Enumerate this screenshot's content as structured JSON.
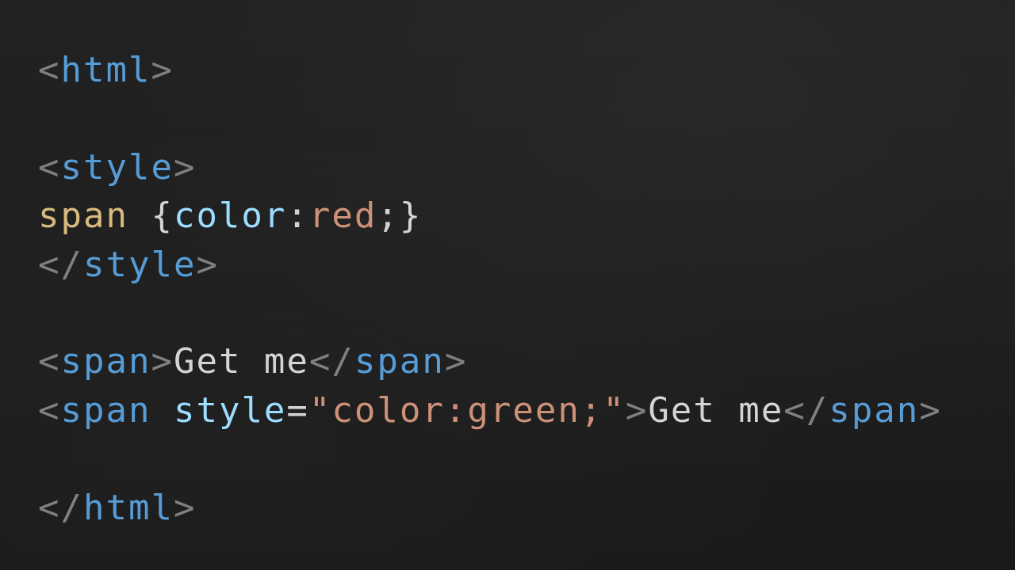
{
  "colors": {
    "background": "#1c1c1c",
    "punctuation": "#808080",
    "tag": "#569cd6",
    "text": "#d4d4d4",
    "selector": "#d7ba7d",
    "property": "#9cdcfe",
    "value": "#ce9178"
  },
  "code": {
    "l1": {
      "open": "<",
      "tag": "html",
      "close": ">"
    },
    "l3": {
      "open": "<",
      "tag": "style",
      "close": ">"
    },
    "l4": {
      "selector": "span",
      "brace_open": " {",
      "property": "color",
      "colon": ":",
      "value": "red",
      "semi": ";",
      "brace_close": "}"
    },
    "l5": {
      "open": "</",
      "tag": "style",
      "close": ">"
    },
    "l7": {
      "open": "<",
      "tag": "span",
      "close": ">",
      "content": "Get me",
      "end_open": "</",
      "end_tag": "span",
      "end_close": ">"
    },
    "l8": {
      "open": "<",
      "tag": "span",
      "space": " ",
      "attr": "style",
      "eq": "=",
      "quote1": "\"",
      "attr_value": "color:green;",
      "quote2": "\"",
      "close": ">",
      "content": "Get me",
      "end_open": "</",
      "end_tag": "span",
      "end_close": ">"
    },
    "l10": {
      "open": "</",
      "tag": "html",
      "close": ">"
    }
  }
}
